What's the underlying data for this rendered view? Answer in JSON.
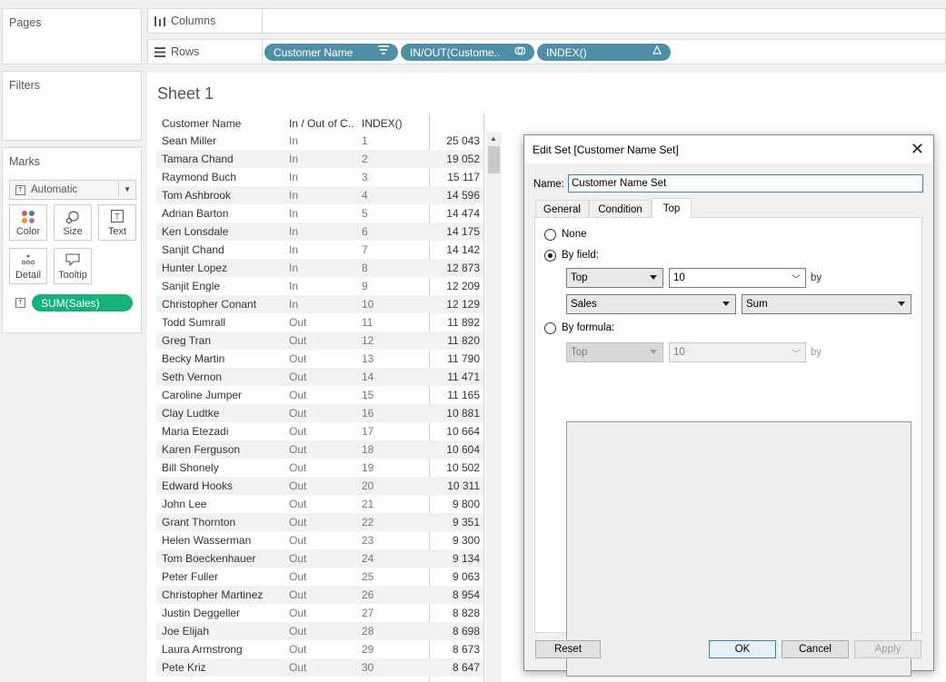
{
  "panels": {
    "pages_title": "Pages",
    "filters_title": "Filters",
    "marks_title": "Marks",
    "marks_type": "Automatic",
    "mark_buttons": [
      {
        "label": "Color",
        "icon": "color-dots-icon"
      },
      {
        "label": "Size",
        "icon": "size-icon"
      },
      {
        "label": "Text",
        "icon": "text-box-icon"
      },
      {
        "label": "Detail",
        "icon": "detail-dots-icon"
      },
      {
        "label": "Tooltip",
        "icon": "tooltip-icon"
      }
    ],
    "marks_pill": "SUM(Sales)",
    "marks_pill_color": "#16b27a"
  },
  "shelves": {
    "columns_label": "Columns",
    "rows_label": "Rows",
    "row_pills": [
      {
        "label": "Customer Name",
        "icon": "sort-icon"
      },
      {
        "label": "IN/OUT(Custome..",
        "icon": "set-icon"
      },
      {
        "label": "INDEX()",
        "icon": "delta-icon"
      }
    ],
    "pill_color": "#4e8fa8"
  },
  "sheet": {
    "title": "Sheet 1",
    "columns": [
      "Customer Name",
      "In / Out of C..",
      "INDEX()"
    ],
    "rows": [
      [
        "Sean Miller",
        "In",
        "1",
        "25 043"
      ],
      [
        "Tamara Chand",
        "In",
        "2",
        "19 052"
      ],
      [
        "Raymond Buch",
        "In",
        "3",
        "15 117"
      ],
      [
        "Tom Ashbrook",
        "In",
        "4",
        "14 596"
      ],
      [
        "Adrian Barton",
        "In",
        "5",
        "14 474"
      ],
      [
        "Ken Lonsdale",
        "In",
        "6",
        "14 175"
      ],
      [
        "Sanjit Chand",
        "In",
        "7",
        "14 142"
      ],
      [
        "Hunter Lopez",
        "In",
        "8",
        "12 873"
      ],
      [
        "Sanjit Engle",
        "In",
        "9",
        "12 209"
      ],
      [
        "Christopher Conant",
        "In",
        "10",
        "12 129"
      ],
      [
        "Todd Sumrall",
        "Out",
        "11",
        "11 892"
      ],
      [
        "Greg Tran",
        "Out",
        "12",
        "11 820"
      ],
      [
        "Becky Martin",
        "Out",
        "13",
        "11 790"
      ],
      [
        "Seth Vernon",
        "Out",
        "14",
        "11 471"
      ],
      [
        "Caroline Jumper",
        "Out",
        "15",
        "11 165"
      ],
      [
        "Clay Ludtke",
        "Out",
        "16",
        "10 881"
      ],
      [
        "Maria Etezadi",
        "Out",
        "17",
        "10 664"
      ],
      [
        "Karen Ferguson",
        "Out",
        "18",
        "10 604"
      ],
      [
        "Bill Shonely",
        "Out",
        "19",
        "10 502"
      ],
      [
        "Edward Hooks",
        "Out",
        "20",
        "10 311"
      ],
      [
        "John Lee",
        "Out",
        "21",
        "9 800"
      ],
      [
        "Grant Thornton",
        "Out",
        "22",
        "9 351"
      ],
      [
        "Helen Wasserman",
        "Out",
        "23",
        "9 300"
      ],
      [
        "Tom Boeckenhauer",
        "Out",
        "24",
        "9 134"
      ],
      [
        "Peter Fuller",
        "Out",
        "25",
        "9 063"
      ],
      [
        "Christopher Martinez",
        "Out",
        "26",
        "8 954"
      ],
      [
        "Justin Deggeller",
        "Out",
        "27",
        "8 828"
      ],
      [
        "Joe Elijah",
        "Out",
        "28",
        "8 698"
      ],
      [
        "Laura Armstrong",
        "Out",
        "29",
        "8 673"
      ],
      [
        "Pete Kriz",
        "Out",
        "30",
        "8 647"
      ]
    ]
  },
  "dialog": {
    "title": "Edit Set [Customer Name Set]",
    "name_label": "Name:",
    "name_value": "Customer Name Set",
    "tabs": [
      "General",
      "Condition",
      "Top"
    ],
    "active_tab": "Top",
    "option_none": "None",
    "option_by_field": "By field:",
    "option_by_formula": "By formula:",
    "by_field": {
      "direction": "Top",
      "count": "10",
      "by": "by",
      "field": "Sales",
      "aggregation": "Sum"
    },
    "by_formula": {
      "direction": "Top",
      "count": "10",
      "by": "by"
    },
    "buttons": {
      "reset": "Reset",
      "ok": "OK",
      "cancel": "Cancel",
      "apply": "Apply"
    }
  }
}
